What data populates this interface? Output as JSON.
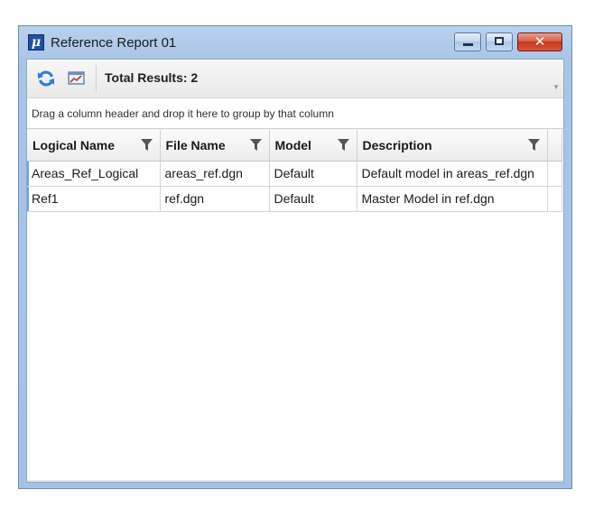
{
  "window": {
    "title": "Reference Report 01",
    "app_icon_glyph": "μ",
    "close_glyph": "✕"
  },
  "toolbar": {
    "total_results": "Total Results: 2",
    "refresh_icon": "refresh-icon",
    "chart_icon": "chart-icon"
  },
  "group_panel": {
    "hint": "Drag a column header and drop it here to group by that column"
  },
  "table": {
    "columns": [
      "Logical Name",
      "File Name",
      "Model",
      "Description"
    ],
    "rows": [
      [
        "Areas_Ref_Logical",
        "areas_ref.dgn",
        "Default",
        "Default model in areas_ref.dgn"
      ],
      [
        "Ref1",
        "ref.dgn",
        "Default",
        "Master Model in ref.dgn"
      ]
    ]
  },
  "colors": {
    "frame": "#a8c5e6",
    "accent": "#2a7fd4",
    "close": "#c2361c"
  }
}
